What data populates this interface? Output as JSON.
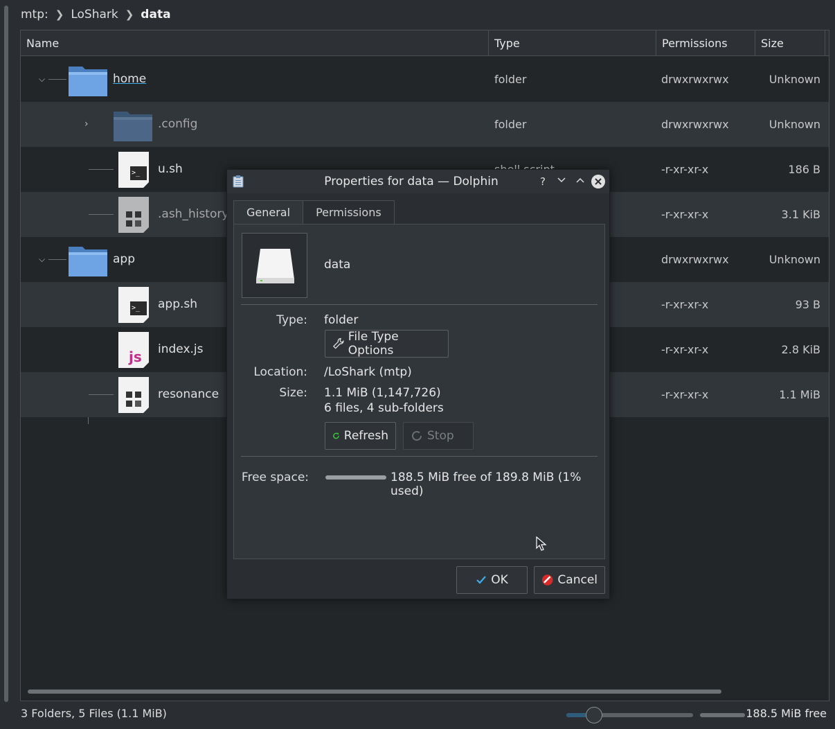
{
  "breadcrumb": {
    "root": "mtp:",
    "device": "LoShark",
    "current": "data"
  },
  "columns": {
    "name": "Name",
    "type": "Type",
    "permissions": "Permissions",
    "size": "Size"
  },
  "rows": [
    {
      "name": "home",
      "type": "folder",
      "permissions": "drwxrwxrwx",
      "size": "Unknown",
      "icon": "folder-icon"
    },
    {
      "name": ".config",
      "type": "folder",
      "permissions": "drwxrwxrwx",
      "size": "Unknown",
      "icon": "folder-icon"
    },
    {
      "name": "u.sh",
      "type": "shell script",
      "permissions": "-r-xr-xr-x",
      "size": "186 B",
      "icon": "script-file-icon"
    },
    {
      "name": ".ash_history",
      "type": "",
      "permissions": "-r-xr-xr-x",
      "size": "3.1 KiB",
      "icon": "binary-file-icon"
    },
    {
      "name": "app",
      "type": "",
      "permissions": "drwxrwxrwx",
      "size": "Unknown",
      "icon": "folder-icon"
    },
    {
      "name": "app.sh",
      "type": "",
      "permissions": "-r-xr-xr-x",
      "size": "93 B",
      "icon": "script-file-icon"
    },
    {
      "name": "index.js",
      "type": "",
      "permissions": "-r-xr-xr-x",
      "size": "2.8 KiB",
      "icon": "javascript-file-icon"
    },
    {
      "name": "resonance",
      "type": "",
      "permissions": "-r-xr-xr-x",
      "size": "1.1 MiB",
      "icon": "binary-file-icon"
    }
  ],
  "statusbar": {
    "summary": "3 Folders, 5 Files (1.1 MiB)",
    "free": "188.5 MiB free"
  },
  "dialog": {
    "title": "Properties for data — Dolphin",
    "help": "?",
    "tabs": [
      "General",
      "Permissions"
    ],
    "item_name": "data",
    "type_label": "Type:",
    "type_value": "folder",
    "file_type_options": "File Type Options",
    "location_label": "Location:",
    "location_value": "/LoShark (mtp)",
    "size_label": "Size:",
    "size_value": "1.1 MiB (1,147,726)",
    "size_detail": "6 files, 4 sub-folders",
    "refresh": "Refresh",
    "stop": "Stop",
    "free_label": "Free space:",
    "free_value": "188.5 MiB free of 189.8 MiB (1% used)",
    "used_fraction": 0.01,
    "ok": "OK",
    "cancel": "Cancel"
  },
  "colors": {
    "accent": "#3daee9",
    "folder": "#5a93d6",
    "background": "#232629"
  }
}
